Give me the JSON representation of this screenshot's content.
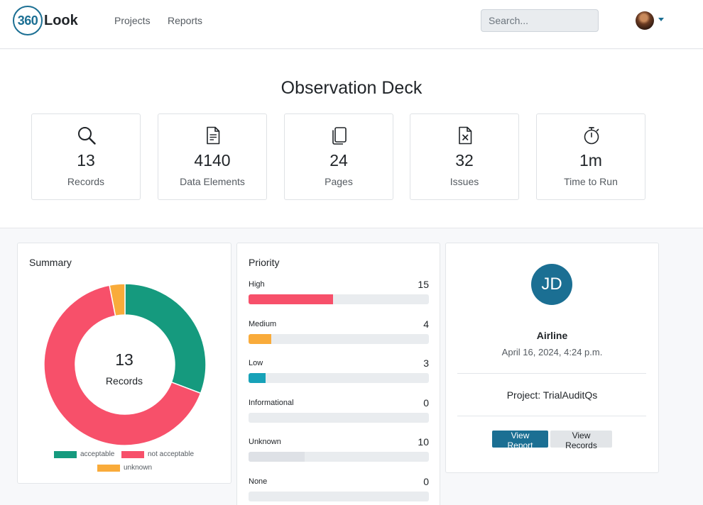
{
  "nav": {
    "logo_number": "360",
    "logo_word": "Look",
    "links": [
      "Projects",
      "Reports"
    ],
    "search_placeholder": "Search..."
  },
  "hero": {
    "title": "Observation Deck",
    "stats": [
      {
        "value": "13",
        "label": "Records",
        "icon": "search-icon"
      },
      {
        "value": "4140",
        "label": "Data Elements",
        "icon": "document-icon"
      },
      {
        "value": "24",
        "label": "Pages",
        "icon": "files-icon"
      },
      {
        "value": "32",
        "label": "Issues",
        "icon": "file-x-icon"
      },
      {
        "value": "1m",
        "label": "Time to Run",
        "icon": "stopwatch-icon"
      }
    ]
  },
  "summary": {
    "title": "Summary",
    "center_value": "13",
    "center_label": "Records",
    "legend": [
      {
        "label": "acceptable",
        "color": "#159a7e"
      },
      {
        "label": "not acceptable",
        "color": "#f7506a"
      },
      {
        "label": "unknown",
        "color": "#f9ab3a"
      }
    ]
  },
  "chart_data": {
    "type": "pie",
    "categories": [
      "acceptable",
      "not acceptable",
      "unknown"
    ],
    "values": [
      4,
      8.6,
      0.4
    ],
    "colors": [
      "#159a7e",
      "#f7506a",
      "#f9ab3a"
    ]
  },
  "priority": {
    "title": "Priority",
    "max": 32,
    "items": [
      {
        "label": "High",
        "count": "15",
        "value": 15,
        "color": "#f7506a"
      },
      {
        "label": "Medium",
        "count": "4",
        "value": 4,
        "color": "#f9ab3a"
      },
      {
        "label": "Low",
        "count": "3",
        "value": 3,
        "color": "#17a2b8"
      },
      {
        "label": "Informational",
        "count": "0",
        "value": 0,
        "color": "#6c757d"
      },
      {
        "label": "Unknown",
        "count": "10",
        "value": 10,
        "color": "#dee1e6"
      },
      {
        "label": "None",
        "count": "0",
        "value": 0,
        "color": "#6c757d"
      }
    ]
  },
  "profile": {
    "initials": "JD",
    "organization": "Airline",
    "date": "April 16, 2024, 4:24 p.m.",
    "project": "Project: TrialAuditQs",
    "view_report": "View Report",
    "view_records": "View Records",
    "accent": "#1b6f93"
  }
}
